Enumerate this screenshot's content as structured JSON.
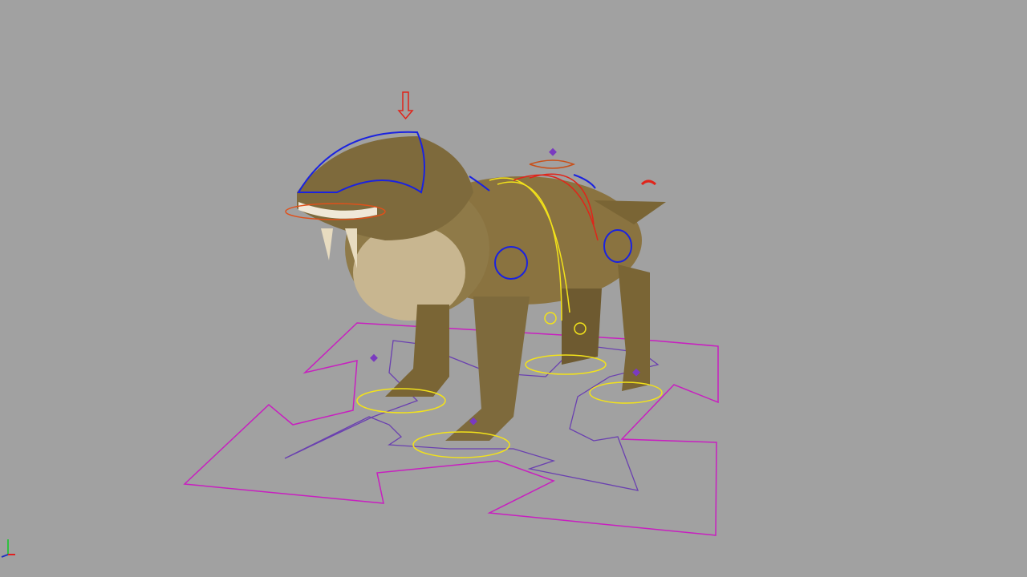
{
  "viewport": {
    "background": "#a1a1a1",
    "colors": {
      "ground_control": "#c81fc0",
      "ground_inner": "#6a40b0",
      "foot_controls": "#f2e21a",
      "fk_controls": "#1a22e0",
      "spine_red": "#e0241a",
      "skin": "#8a7340",
      "belly": "#c8b690"
    }
  },
  "axis_gizmo": {
    "axes": [
      "x",
      "y",
      "z"
    ]
  }
}
